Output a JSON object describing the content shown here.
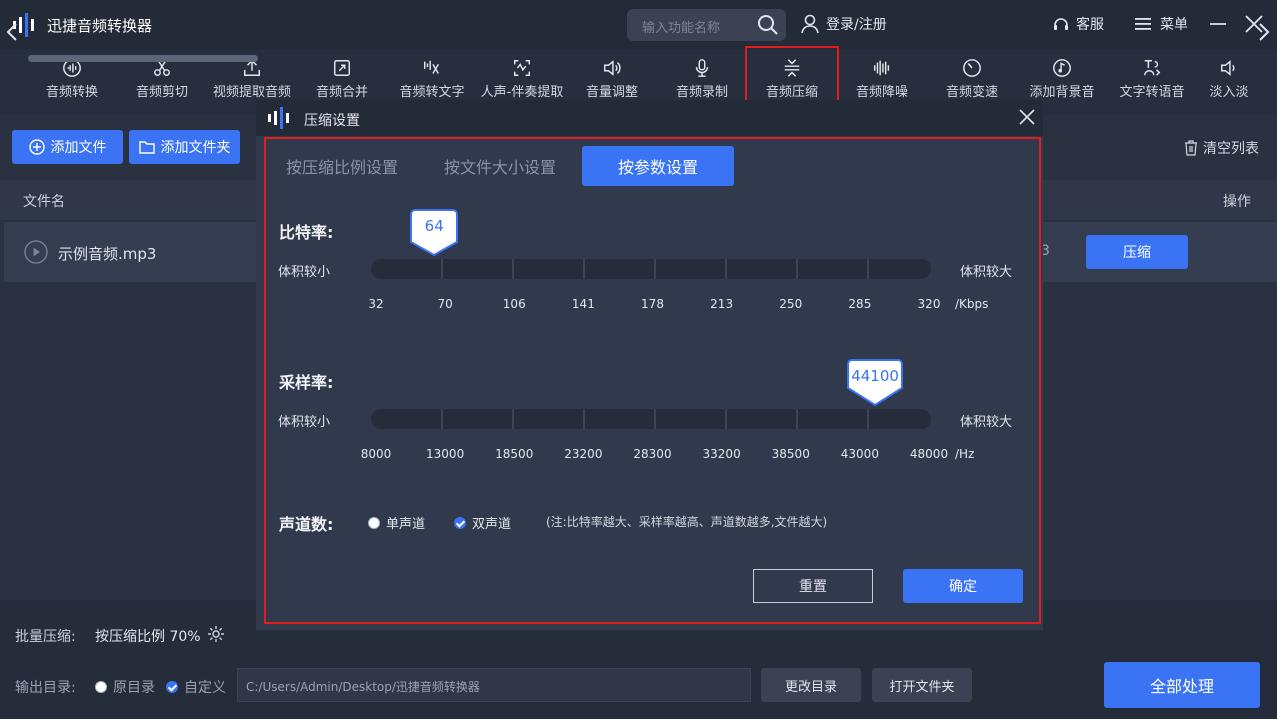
{
  "app": {
    "title": "迅捷音频转换器"
  },
  "search": {
    "placeholder": "输入功能名称"
  },
  "header": {
    "login": "登录/注册",
    "service": "客服",
    "menu": "菜单"
  },
  "toolbar": {
    "tools": [
      {
        "label": "音频转换",
        "icon": "waveform-circle-icon"
      },
      {
        "label": "音频剪切",
        "icon": "scissors-icon"
      },
      {
        "label": "视频提取音频",
        "icon": "upload-icon"
      },
      {
        "label": "音频合并",
        "icon": "merge-icon"
      },
      {
        "label": "音频转文字",
        "icon": "text-convert-icon"
      },
      {
        "label": "人声-伴奏提取",
        "icon": "vocal-extract-icon"
      },
      {
        "label": "音量调整",
        "icon": "volume-icon"
      },
      {
        "label": "音频录制",
        "icon": "microphone-icon"
      },
      {
        "label": "音频压缩",
        "icon": "compress-icon"
      },
      {
        "label": "音频降噪",
        "icon": "noise-bars-icon"
      },
      {
        "label": "音频变速",
        "icon": "speed-icon"
      },
      {
        "label": "添加背景音",
        "icon": "music-note-icon"
      },
      {
        "label": "文字转语音",
        "icon": "text-speech-icon"
      },
      {
        "label": "淡入淡",
        "icon": "fade-icon"
      }
    ],
    "selected_index": 8
  },
  "main": {
    "add_file": "添加文件",
    "add_folder": "添加文件夹",
    "clear_list": "清空列表",
    "col_name": "文件名",
    "col_action": "操作",
    "row": {
      "name": "示例音频.mp3",
      "fragment": "3",
      "action": "压缩"
    }
  },
  "bottom": {
    "batch_label": "批量压缩:",
    "batch_value": "按压缩比例 70%",
    "output_label": "输出目录:",
    "opt_original": "原目录",
    "opt_custom": "自定义",
    "output_path": "C:/Users/Admin/Desktop/迅捷音频转换器",
    "change_dir": "更改目录",
    "open_folder": "打开文件夹",
    "process_all": "全部处理"
  },
  "dialog": {
    "title": "压缩设置",
    "tabs": [
      "按压缩比例设置",
      "按文件大小设置",
      "按参数设置"
    ],
    "active_tab": 2,
    "bitrate": {
      "label": "比特率:",
      "min_label": "体积较小",
      "max_label": "体积较大",
      "ticks": [
        "32",
        "70",
        "106",
        "141",
        "178",
        "213",
        "250",
        "285",
        "320"
      ],
      "unit": "/Kbps",
      "value": "64"
    },
    "samplerate": {
      "label": "采样率:",
      "min_label": "体积较小",
      "max_label": "体积较大",
      "ticks": [
        "8000",
        "13000",
        "18500",
        "23200",
        "28300",
        "33200",
        "38500",
        "43000",
        "48000"
      ],
      "unit": "/Hz",
      "value": "44100"
    },
    "channels": {
      "label": "声道数:",
      "mono": "单声道",
      "stereo": "双声道",
      "selected": "stereo",
      "note": "(注:比特率越大、采样率越高、声道数越多,文件越大)"
    },
    "reset": "重置",
    "ok": "确定"
  },
  "colors": {
    "accent": "#3a74f5",
    "highlight": "#e11c1c"
  }
}
